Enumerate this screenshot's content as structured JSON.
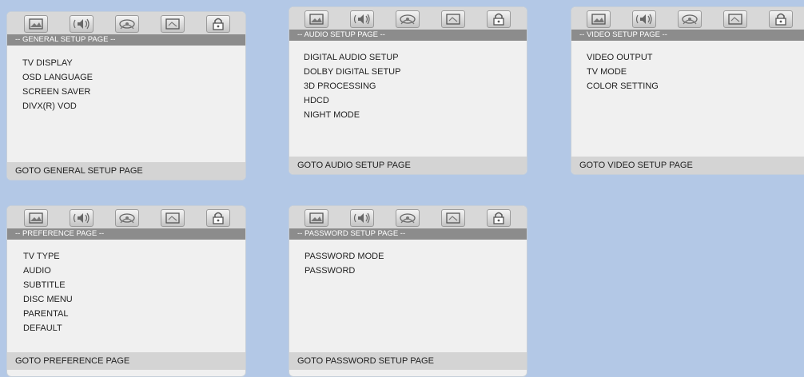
{
  "colors": {
    "background": "#b3c8e6",
    "panel": "#f0f0f0",
    "title_bar": "#8c8c8c",
    "footer_bar": "#d4d4d4"
  },
  "icon_tabs": [
    "general-setup-icon",
    "audio-setup-icon",
    "video-setup-icon",
    "preference-icon",
    "password-lock-icon"
  ],
  "panels": [
    {
      "title": "-- GENERAL SETUP PAGE --",
      "items": [
        "TV DISPLAY",
        "OSD LANGUAGE",
        "SCREEN SAVER",
        "DIVX(R) VOD"
      ],
      "footer": "GOTO GENERAL SETUP PAGE"
    },
    {
      "title": "-- AUDIO SETUP PAGE --",
      "items": [
        "DIGITAL AUDIO SETUP",
        "DOLBY DIGITAL SETUP",
        "3D PROCESSING",
        "HDCD",
        "NIGHT MODE"
      ],
      "footer": "GOTO AUDIO SETUP PAGE"
    },
    {
      "title": "-- VIDEO SETUP PAGE --",
      "items": [
        "VIDEO OUTPUT",
        "TV MODE",
        "COLOR SETTING"
      ],
      "footer": "GOTO VIDEO SETUP PAGE"
    },
    {
      "title": "-- PREFERENCE PAGE --",
      "items": [
        "TV TYPE",
        "AUDIO",
        "SUBTITLE",
        "DISC MENU",
        "PARENTAL",
        "DEFAULT"
      ],
      "footer": "GOTO PREFERENCE PAGE"
    },
    {
      "title": "-- PASSWORD SETUP PAGE --",
      "items": [
        "PASSWORD MODE",
        "PASSWORD"
      ],
      "footer": "GOTO PASSWORD SETUP PAGE"
    }
  ]
}
